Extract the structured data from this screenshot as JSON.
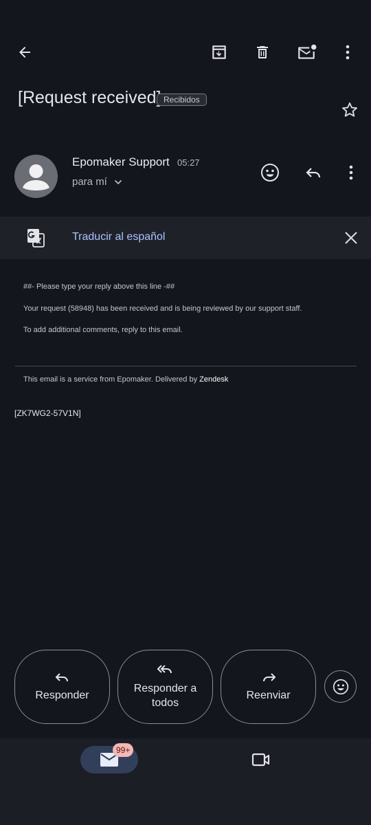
{
  "toolbar": {
    "back_icon": "arrow-back-icon",
    "archive_icon": "archive-icon",
    "delete_icon": "trash-icon",
    "mark_unread_icon": "mail-unread-icon",
    "more_icon": "more-vert-icon"
  },
  "email": {
    "subject": "[Request received]",
    "label": "Recibidos",
    "starred": false
  },
  "sender": {
    "name": "Epomaker Support",
    "time": "05:27",
    "recipient": "para mí"
  },
  "translate": {
    "text": "Traducir al español"
  },
  "body": {
    "line1": "##- Please type your reply above this line -##",
    "line2": "Your request (58948) has been received and is being reviewed by our support staff.",
    "line3": "To add additional comments, reply to this email.",
    "footer_prefix": "This email is a service from Epomaker. Delivered by ",
    "footer_brand": "Zendesk",
    "ref_code": "[ZK7WG2-57V1N]"
  },
  "actions": {
    "reply": "Responder",
    "reply_all": "Responder a todos",
    "forward": "Reenviar"
  },
  "nav": {
    "mail_badge": "99+"
  },
  "colors": {
    "background": "#14161d",
    "link": "#a9c4ff",
    "badge": "#f2b8b5"
  }
}
